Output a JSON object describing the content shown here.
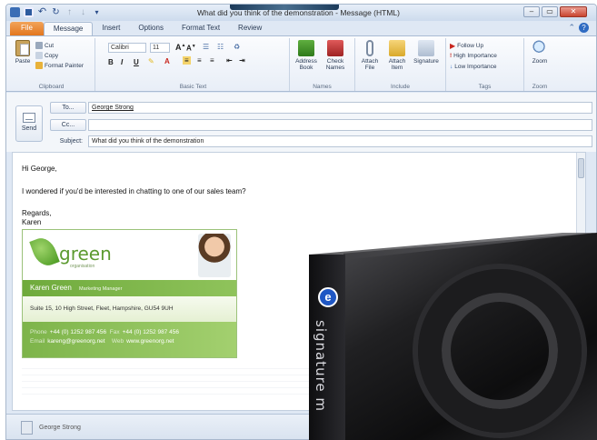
{
  "window": {
    "title": "What did you think of the demonstration - Message (HTML)",
    "controls": {
      "minimize": "–",
      "maximize": "▭",
      "close": "✕"
    }
  },
  "quick_access": [
    "save-icon",
    "undo-icon",
    "redo-icon",
    "up-icon",
    "down-icon",
    "customize-icon"
  ],
  "tabs": [
    {
      "label": "File"
    },
    {
      "label": "Message"
    },
    {
      "label": "Insert"
    },
    {
      "label": "Options"
    },
    {
      "label": "Format Text"
    },
    {
      "label": "Review"
    }
  ],
  "ribbon": {
    "clipboard": {
      "paste": "Paste",
      "cut": "Cut",
      "copy": "Copy",
      "format_painter": "Format Painter",
      "label": "Clipboard"
    },
    "basic_text": {
      "font": "Calibri",
      "size": "11",
      "label": "Basic Text",
      "bold": "B",
      "italic": "I",
      "underline": "U"
    },
    "names": {
      "address_book": "Address Book",
      "check_names": "Check Names",
      "label": "Names"
    },
    "include": {
      "attach_file": "Attach File",
      "attach_item": "Attach Item",
      "signature": "Signature",
      "label": "Include"
    },
    "tags": {
      "follow_up": "Follow Up",
      "high_importance": "High Importance",
      "low_importance": "Low Importance",
      "label": "Tags"
    },
    "zoom": {
      "zoom": "Zoom",
      "label": "Zoom"
    }
  },
  "header": {
    "send": "Send",
    "to_label": "To...",
    "to_value": "George Strong",
    "cc_label": "Cc...",
    "cc_value": "",
    "subject_label": "Subject:",
    "subject_value": "What did you think of the demonstration"
  },
  "message": {
    "greeting": "Hi George,",
    "line1": "I wondered if you'd be interested in chatting to one of our sales team?",
    "regards": "Regards,",
    "signoff": "Karen"
  },
  "signature_card": {
    "brand": "green",
    "brand_sub": "organisation",
    "name": "Karen Green",
    "role": "Marketing Manager",
    "address": "Suite 15, 10 High Street, Fleet, Hampshire, GU54 9UH",
    "phone_label": "Phone",
    "phone": "+44 (0) 1252 987 456",
    "fax_label": "Fax",
    "fax": "+44 (0) 1252 987 456",
    "email_label": "Email",
    "email": "kareng@greenorg.net",
    "web_label": "Web",
    "web": "www.greenorg.net"
  },
  "footer": {
    "person": "George Strong"
  },
  "product_box": {
    "text": "signature m"
  },
  "colors": {
    "file_tab": "#e3761e",
    "accent_green": "#6faa3c",
    "logo_blue": "#1f57c4"
  }
}
